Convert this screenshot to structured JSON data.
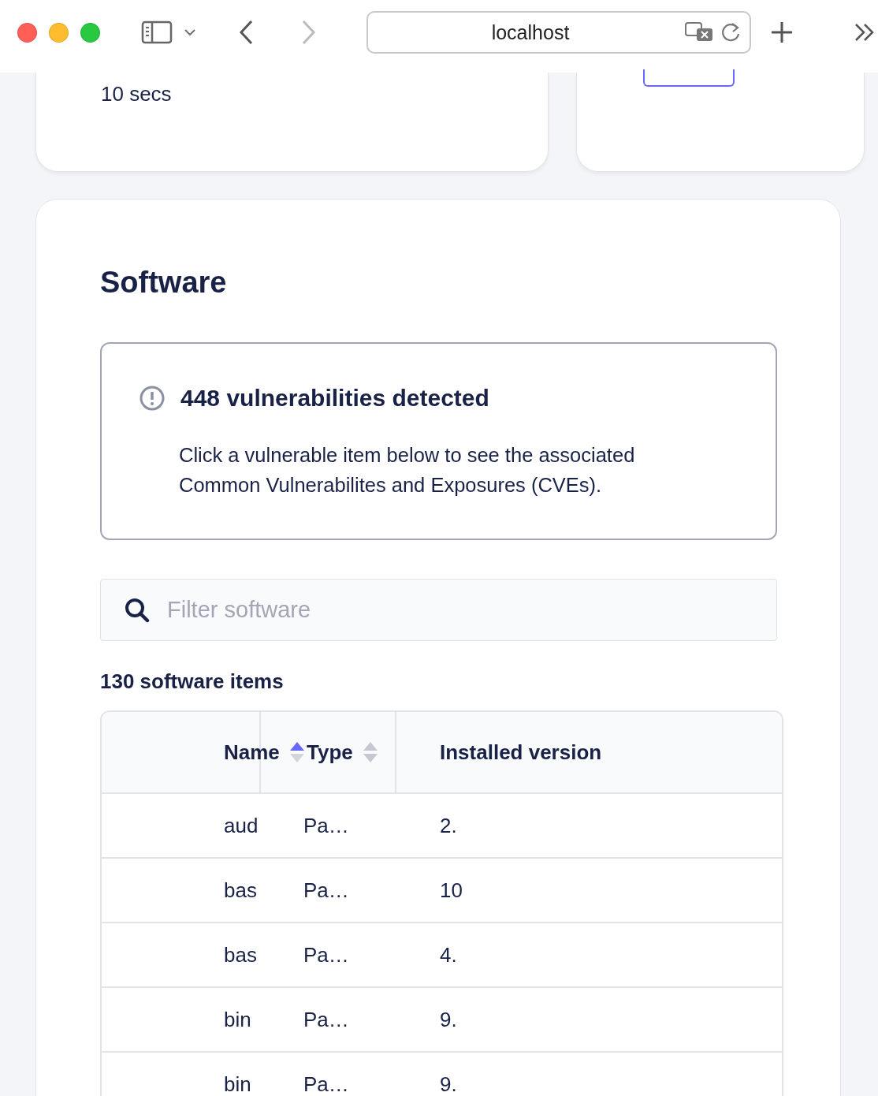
{
  "browser": {
    "address": "localhost"
  },
  "top_cards": [
    {
      "kind": "text",
      "text": "10 secs"
    },
    {
      "kind": "button_fragment"
    }
  ],
  "software": {
    "title": "Software",
    "alert": {
      "title": "448 vulnerabilities detected",
      "message": "Click a vulnerable item below to see the associated Common Vulnerabilites and Exposures (CVEs)."
    },
    "search": {
      "placeholder": "Filter software"
    },
    "count": "130 software items",
    "table": {
      "columns": [
        {
          "label": "Name",
          "sortable": true,
          "sorted": true
        },
        {
          "label": "Type",
          "sortable": true,
          "sorted": false
        },
        {
          "label": "Installed version",
          "sortable": false
        }
      ],
      "rows": [
        {
          "name": "aud",
          "type": "Pa…",
          "version": "2."
        },
        {
          "name": "bas",
          "type": "Pa…",
          "version": "10"
        },
        {
          "name": "bas",
          "type": "Pa…",
          "version": "4."
        },
        {
          "name": "bin",
          "type": "Pa…",
          "version": "9."
        },
        {
          "name": "bin",
          "type": "Pa…",
          "version": "9."
        }
      ]
    }
  }
}
